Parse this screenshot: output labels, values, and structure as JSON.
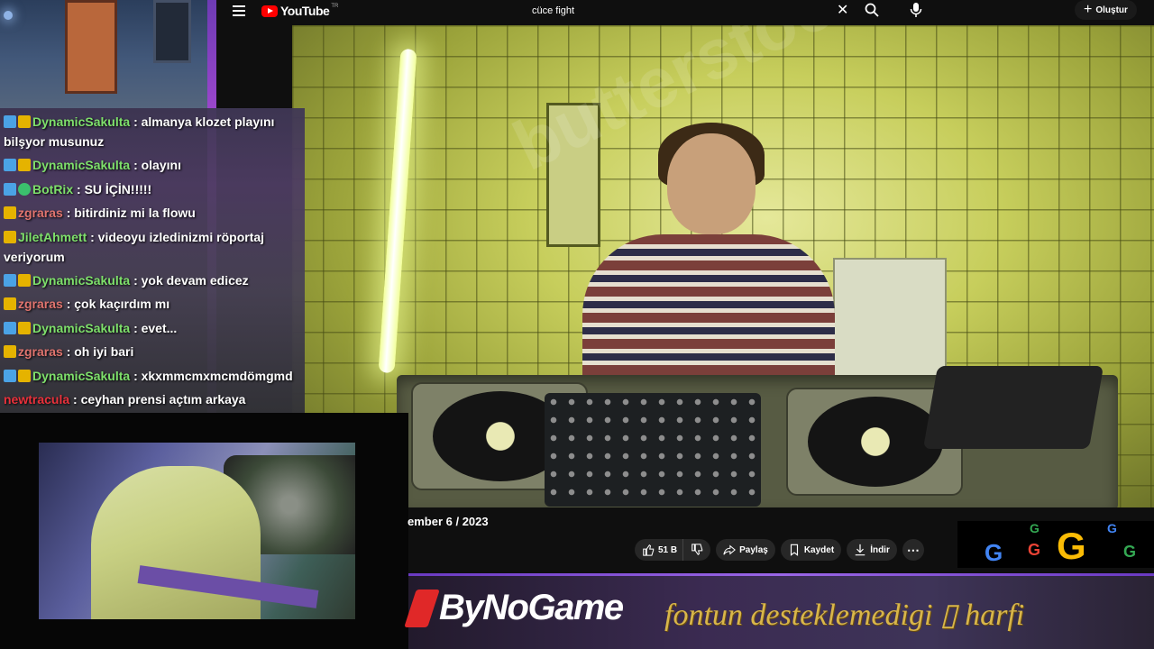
{
  "topbar": {
    "brand": "YouTube",
    "country_code": "TR",
    "search_value": "cüce fight",
    "create_label": "Oluştur"
  },
  "video": {
    "watermark": "butterstock"
  },
  "chat": {
    "messages": [
      {
        "user": "DynamicSakulta",
        "text": ": almanya klozet playını bilşyor musunuz",
        "color": "#7ee06b",
        "badges": [
          "prime",
          "sub"
        ]
      },
      {
        "user": "DynamicSakulta",
        "text": ": olayını",
        "color": "#7ee06b",
        "badges": [
          "prime",
          "sub"
        ]
      },
      {
        "user": "BotRix",
        "text": ": SU İÇİN!!!!!",
        "color": "#7ee06b",
        "badges": [
          "prime",
          "bot"
        ]
      },
      {
        "user": "zgraras",
        "text": ": bitirdiniz mi la flowu",
        "color": "#e0746e",
        "badges": [
          "sub"
        ]
      },
      {
        "user": "JiletAhmett",
        "text": ": videoyu izledinizmi röportaj veriyorum",
        "color": "#7ee06b",
        "badges": [
          "sub"
        ]
      },
      {
        "user": "DynamicSakulta",
        "text": ": yok devam edicez",
        "color": "#7ee06b",
        "badges": [
          "prime",
          "sub"
        ]
      },
      {
        "user": "zgraras",
        "text": ": çok kaçırdım mı",
        "color": "#e0746e",
        "badges": [
          "sub"
        ]
      },
      {
        "user": "DynamicSakulta",
        "text": ": evet...",
        "color": "#7ee06b",
        "badges": [
          "prime",
          "sub"
        ]
      },
      {
        "user": "zgraras",
        "text": ": oh iyi bari",
        "color": "#e0746e",
        "badges": [
          "sub"
        ]
      },
      {
        "user": "DynamicSakulta",
        "text": ": xkxmmcmxmcmdömgmd",
        "color": "#7ee06b",
        "badges": [
          "prime",
          "sub"
        ]
      },
      {
        "user": "newtracula",
        "text": ": ceyhan prensi açtım arkaya",
        "color": "#e8313b",
        "badges": []
      }
    ]
  },
  "meta": {
    "date": "ember 6 / 2023",
    "like_count": "51 B",
    "share_label": "Paylaş",
    "save_label": "Kaydet",
    "download_label": "İndir",
    "more_label": "⋯"
  },
  "banner": {
    "brand": "ByNoGame",
    "fallback_text": "fontun desteklemedigi ▯ harfi"
  }
}
